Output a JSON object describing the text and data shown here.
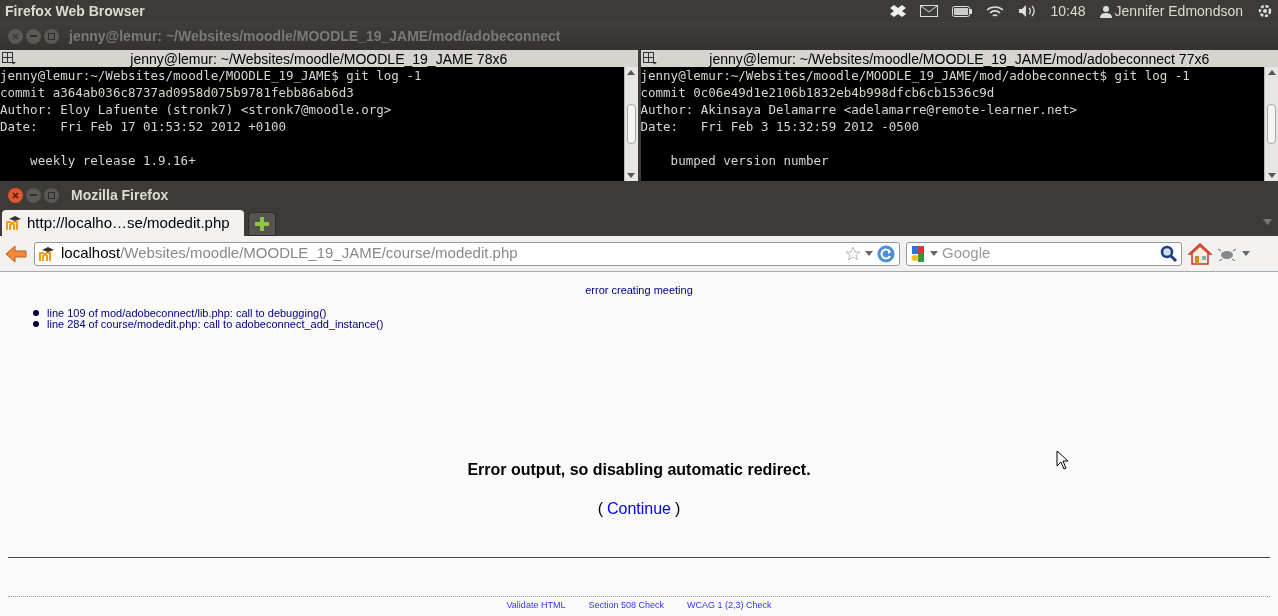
{
  "top_panel": {
    "app_title": "Firefox Web Browser",
    "clock": "10:48",
    "user": "Jennifer Edmondson"
  },
  "terminal_window": {
    "title": "jenny@lemur: ~/Websites/moodle/MOODLE_19_JAME/mod/adobeconnect",
    "panes": [
      {
        "title": "jenny@lemur: ~/Websites/moodle/MOODLE_19_JAME 78x6",
        "lines": [
          "jenny@lemur:~/Websites/moodle/MOODLE_19_JAME$ git log -1",
          "commit a364ab036c8737ad0958d075b9781febb86ab6d3",
          "Author: Eloy Lafuente (stronk7) <stronk7@moodle.org>",
          "Date:   Fri Feb 17 01:53:52 2012 +0100"
        ],
        "message": "    weekly release 1.9.16+"
      },
      {
        "title": "jenny@lemur: ~/Websites/moodle/MOODLE_19_JAME/mod/adobeconnect 77x6",
        "lines": [
          "jenny@lemur:~/Websites/moodle/MOODLE_19_JAME/mod/adobeconnect$ git log -1",
          "commit 0c06e49d1e2106b1832eb4b998dfcb6cb1536c9d",
          "Author: Akinsaya Delamarre <adelamarre@remote-learner.net>",
          "Date:   Fri Feb 3 15:32:59 2012 -0500"
        ],
        "message": "    bumped version number"
      }
    ]
  },
  "browser": {
    "title": "Mozilla Firefox",
    "tabs": [
      {
        "label": "http://localho…se/modedit.php",
        "selected": true
      }
    ],
    "url": {
      "host": "localhost",
      "path": "/Websites/moodle/MOODLE_19_JAME/course/modedit.php"
    },
    "search": {
      "placeholder": "Google"
    },
    "page": {
      "error_heading": "error creating meeting",
      "trace": [
        "line 109 of mod/adobeconnect/lib.php: call to debugging()",
        "line 284 of course/modedit.php: call to adobeconnect_add_instance()"
      ],
      "notice": "Error output, so disabling automatic redirect.",
      "continue": {
        "open": "(",
        "link": "Continue",
        "close": ")"
      },
      "footer_links": [
        "Validate HTML",
        "Section 508 Check",
        "WCAG 1 (2,3) Check"
      ]
    }
  }
}
